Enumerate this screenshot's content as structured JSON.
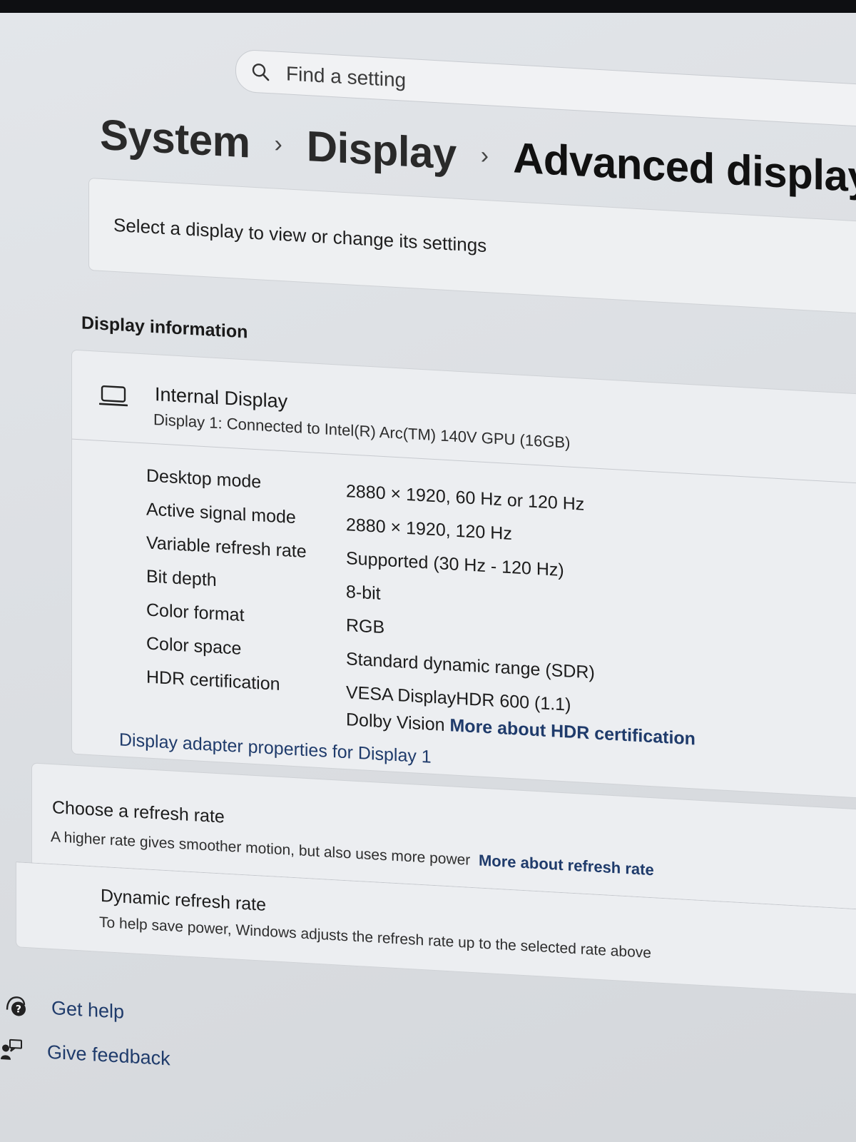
{
  "search": {
    "placeholder": "Find a setting"
  },
  "breadcrumb": [
    {
      "label": "System"
    },
    {
      "label": "Display"
    },
    {
      "label": "Advanced display"
    }
  ],
  "select_display": {
    "text": "Select a display to view or change its settings"
  },
  "display_information": {
    "heading": "Display information",
    "display_name": "Internal Display",
    "display_connection": "Display 1: Connected to Intel(R) Arc(TM) 140V GPU (16GB)",
    "properties": [
      {
        "label": "Desktop mode",
        "value": "2880 × 1920, 60 Hz or 120 Hz"
      },
      {
        "label": "Active signal mode",
        "value": "2880 × 1920, 120 Hz"
      },
      {
        "label": "Variable refresh rate",
        "value": "Supported (30 Hz - 120 Hz)"
      },
      {
        "label": "Bit depth",
        "value": "8-bit"
      },
      {
        "label": "Color format",
        "value": "RGB"
      },
      {
        "label": "Color space",
        "value": "Standard dynamic range (SDR)"
      },
      {
        "label": "HDR certification",
        "value": "VESA DisplayHDR 600 (1.1)",
        "value_line2": "Dolby Vision",
        "link": "More about HDR certification"
      }
    ],
    "adapter_link": "Display adapter properties for Display 1"
  },
  "refresh_rate": {
    "title": "Choose a refresh rate",
    "description": "A higher rate gives smoother motion, but also uses more power",
    "link": "More about refresh rate"
  },
  "dynamic_refresh": {
    "title": "Dynamic refresh rate",
    "description": "To help save power, Windows adjusts the refresh rate up to the selected rate above"
  },
  "footer": {
    "get_help": "Get help",
    "give_feedback": "Give feedback"
  },
  "colors": {
    "link": "#1f3b6b",
    "card": "#eceef1",
    "background": "#dcdfe3"
  }
}
